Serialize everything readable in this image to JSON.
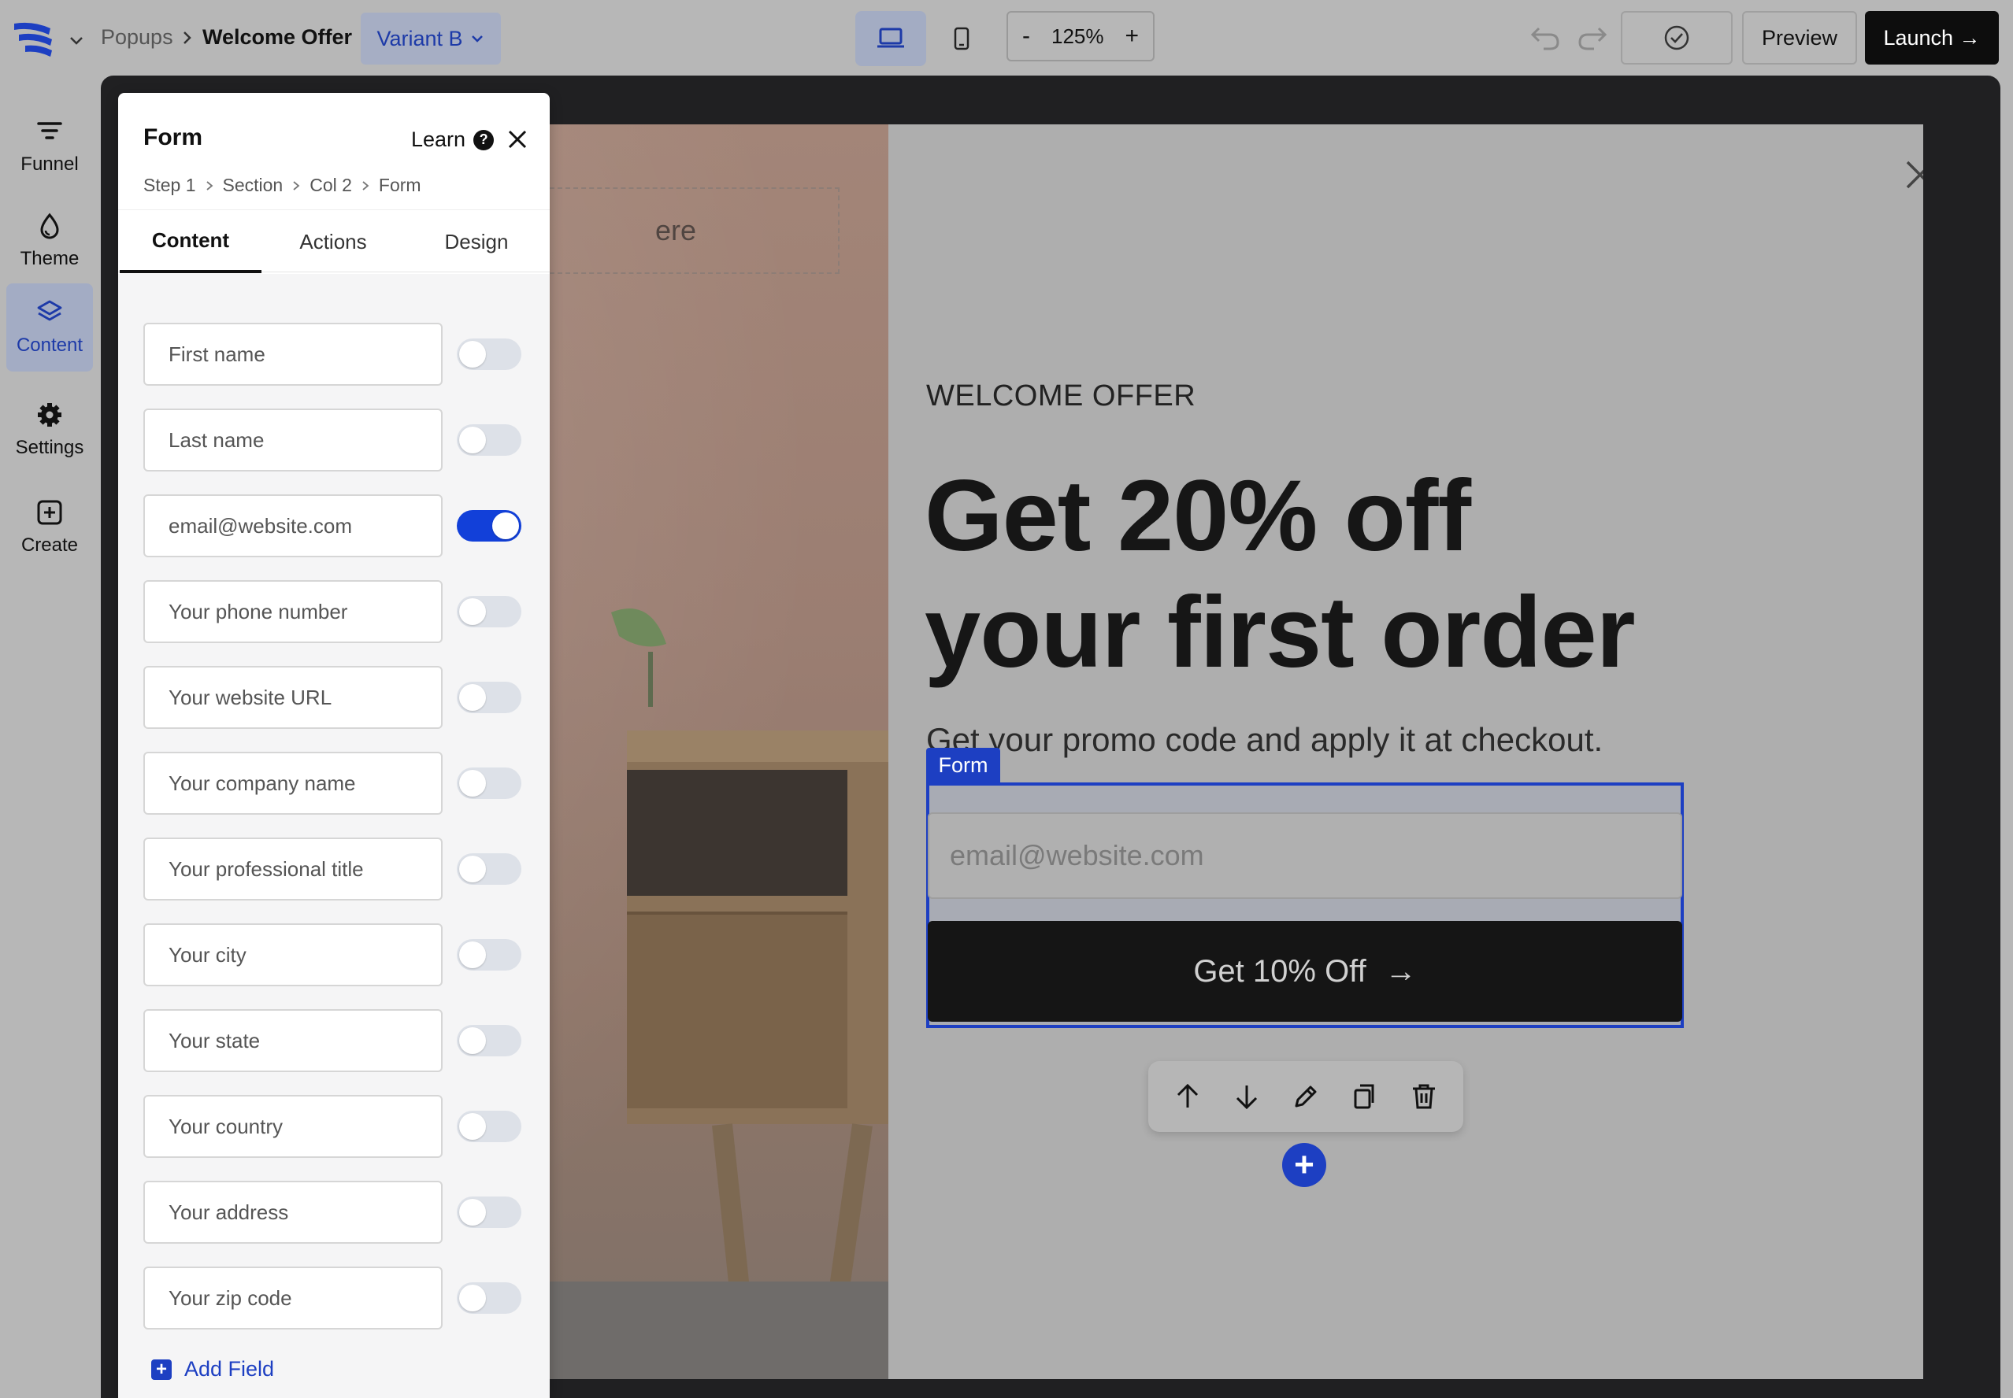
{
  "topbar": {
    "breadcrumb_parent": "Popups",
    "breadcrumb_current": "Welcome Offer",
    "variant": "Variant B",
    "zoom": "125%",
    "zoom_minus": "-",
    "zoom_plus": "+",
    "preview_label": "Preview",
    "launch_label": "Launch →"
  },
  "rail": {
    "items": [
      {
        "label": "Funnel",
        "icon": "funnel-icon"
      },
      {
        "label": "Theme",
        "icon": "droplet-icon"
      },
      {
        "label": "Content",
        "icon": "layers-icon",
        "active": true
      },
      {
        "label": "Settings",
        "icon": "gear-icon"
      },
      {
        "label": "Create",
        "icon": "plus-square-icon"
      }
    ]
  },
  "panel": {
    "title": "Form",
    "learn_label": "Learn",
    "help_glyph": "?",
    "breadcrumb": [
      "Step 1",
      "Section",
      "Col 2",
      "Form"
    ],
    "tabs": [
      "Content",
      "Actions",
      "Design"
    ],
    "active_tab": "Content",
    "fields": [
      {
        "placeholder": "First name",
        "enabled": false
      },
      {
        "placeholder": "Last name",
        "enabled": false
      },
      {
        "placeholder": "email@website.com",
        "enabled": true
      },
      {
        "placeholder": "Your phone number",
        "enabled": false
      },
      {
        "placeholder": "Your website URL",
        "enabled": false
      },
      {
        "placeholder": "Your company name",
        "enabled": false
      },
      {
        "placeholder": "Your professional title",
        "enabled": false
      },
      {
        "placeholder": "Your city",
        "enabled": false
      },
      {
        "placeholder": "Your state",
        "enabled": false
      },
      {
        "placeholder": "Your country",
        "enabled": false
      },
      {
        "placeholder": "Your address",
        "enabled": false
      },
      {
        "placeholder": "Your zip code",
        "enabled": false
      }
    ],
    "add_field_label": "Add Field"
  },
  "popup": {
    "image_placeholder_text": "ere",
    "eyebrow": "WELCOME OFFER",
    "headline_line1": "Get 20% off",
    "headline_line2": "your first order",
    "subtext": "Get your promo code and apply it at checkout.",
    "form_tag": "Form",
    "email_placeholder": "email@website.com",
    "cta_label": "Get 10% Off",
    "cta_arrow": "→",
    "add_block_glyph": "+"
  },
  "colors": {
    "accent": "#1d3fc2",
    "toggle_on": "#1240d9",
    "launch_bg": "#0d0d0d",
    "overlay": "#b7b7b7"
  }
}
